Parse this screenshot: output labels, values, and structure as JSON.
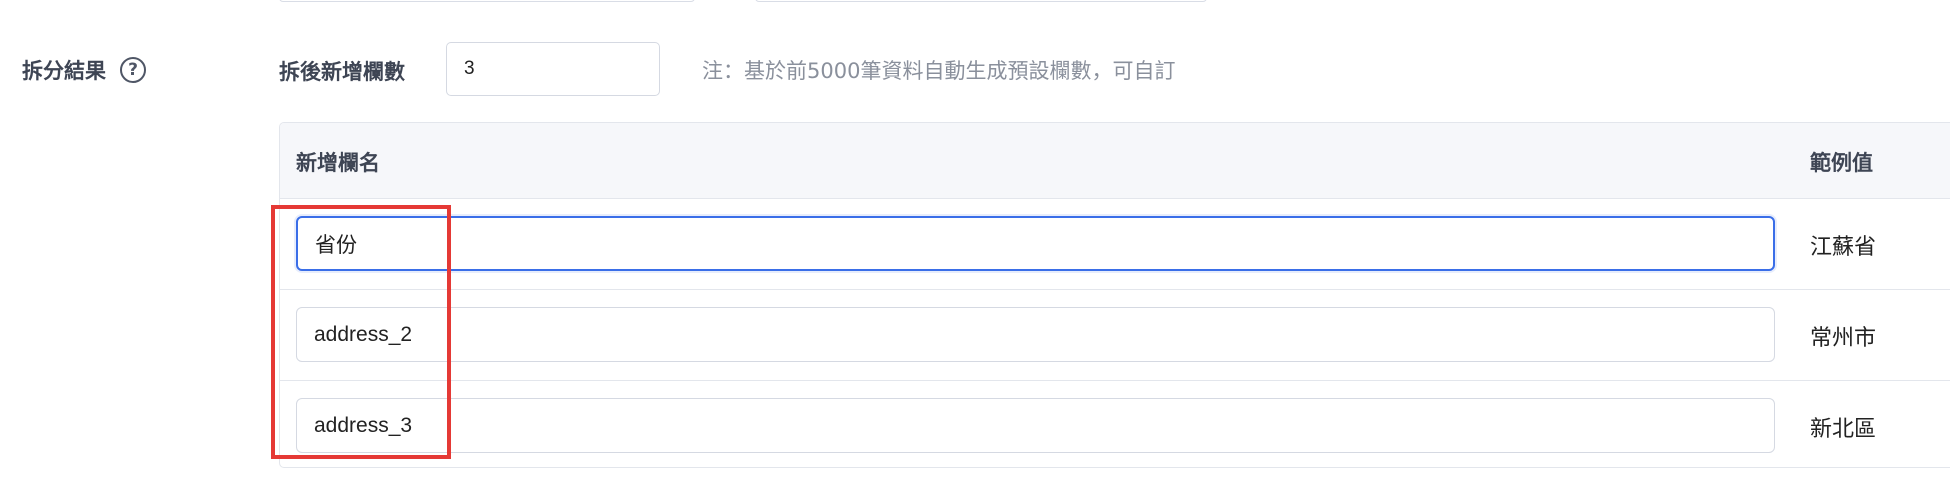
{
  "split_result": {
    "label": "拆分結果",
    "help_icon_glyph": "?"
  },
  "new_column_count": {
    "label": "拆後新增欄數",
    "value": "3",
    "note": "注：基於前5000筆資料自動生成預設欄數，可自訂"
  },
  "table": {
    "headers": {
      "name": "新增欄名",
      "example": "範例值"
    },
    "rows": [
      {
        "name": "省份",
        "example": "江蘇省"
      },
      {
        "name": "address_2",
        "example": "常州市"
      },
      {
        "name": "address_3",
        "example": "新北區"
      }
    ]
  },
  "colors": {
    "focus_border": "#3a6ee8",
    "highlight_box": "#e53935"
  }
}
